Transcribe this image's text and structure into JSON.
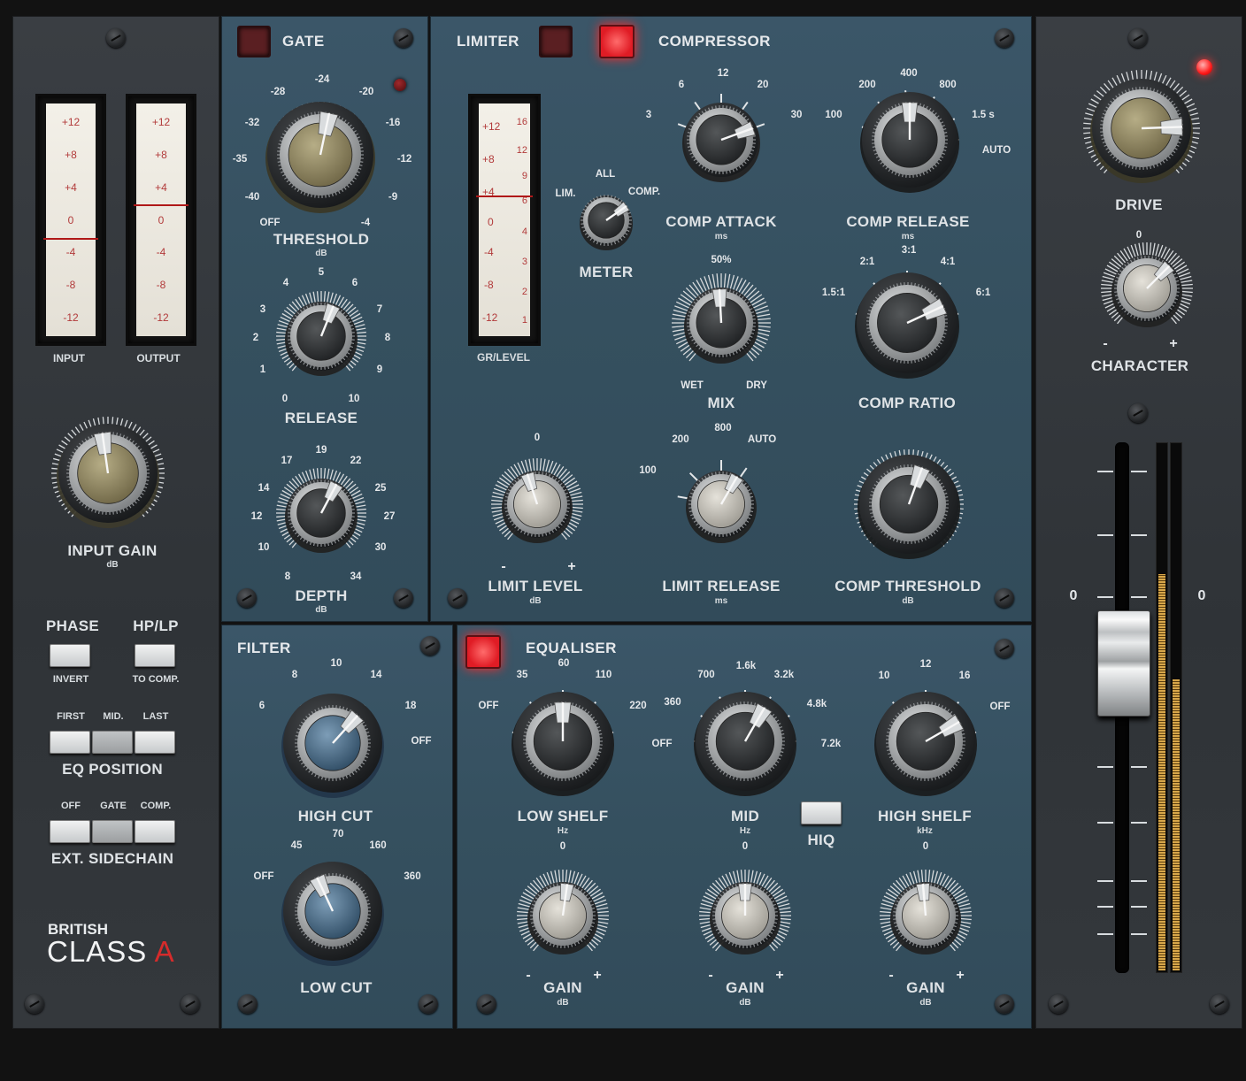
{
  "input_section": {
    "input_meter_label": "INPUT",
    "output_meter_label": "OUTPUT",
    "meter_scale": [
      "+12",
      "+8",
      "+4",
      "0",
      "-4",
      "-8",
      "-12"
    ],
    "input_gain": {
      "label": "INPUT GAIN",
      "unit": "dB"
    },
    "phase": {
      "label": "PHASE",
      "sub": "INVERT"
    },
    "hplp": {
      "label": "HP/LP",
      "sub": "TO COMP."
    },
    "eq_position": {
      "label": "EQ POSITION",
      "options": [
        "FIRST",
        "MID.",
        "LAST"
      ]
    },
    "ext_sidechain": {
      "label": "EXT. SIDECHAIN",
      "options": [
        "OFF",
        "GATE",
        "COMP."
      ]
    },
    "brand": {
      "line1": "BRITISH",
      "line2a": "CLASS ",
      "line2b": "A"
    }
  },
  "gate": {
    "title": "GATE",
    "threshold": {
      "label": "THRESHOLD",
      "unit": "dB",
      "scale": [
        "OFF",
        "-40",
        "-35",
        "-32",
        "-28",
        "-24",
        "-20",
        "-16",
        "-12",
        "-9",
        "-4"
      ]
    },
    "release": {
      "label": "RELEASE",
      "scale": [
        "0",
        "1",
        "2",
        "3",
        "4",
        "5",
        "6",
        "7",
        "8",
        "9",
        "10"
      ]
    },
    "depth": {
      "label": "DEPTH",
      "unit": "dB",
      "scale": [
        "8",
        "10",
        "12",
        "14",
        "17",
        "19",
        "22",
        "25",
        "27",
        "30",
        "34"
      ]
    }
  },
  "compressor": {
    "limiter_title": "LIMITER",
    "compressor_title": "COMPRESSOR",
    "gr_meter_label": "GR/LEVEL",
    "gr_scale_left": [
      "+12",
      "+8",
      "+4",
      "0",
      "-4",
      "-8",
      "-12"
    ],
    "gr_scale_right": [
      "16",
      "12",
      "9",
      "6",
      "4",
      "3",
      "2",
      "1"
    ],
    "meter": {
      "label": "METER",
      "options": [
        "LIM.",
        "ALL",
        "COMP."
      ]
    },
    "comp_attack": {
      "label": "COMP ATTACK",
      "unit": "ms",
      "scale": [
        "3",
        "6",
        "12",
        "20",
        "30"
      ]
    },
    "comp_release": {
      "label": "COMP RELEASE",
      "unit": "ms",
      "scale": [
        "100",
        "200",
        "400",
        "800",
        "1.5 s",
        "AUTO"
      ]
    },
    "mix": {
      "label": "MIX",
      "top": "50%",
      "left": "WET",
      "right": "DRY"
    },
    "comp_ratio": {
      "label": "COMP RATIO",
      "scale": [
        "1.5:1",
        "2:1",
        "3:1",
        "4:1",
        "6:1"
      ]
    },
    "limit_level": {
      "label": "LIMIT LEVEL",
      "unit": "dB",
      "top": "0",
      "minus": "-",
      "plus": "+"
    },
    "limit_release": {
      "label": "LIMIT RELEASE",
      "unit": "ms",
      "scale": [
        "100",
        "200",
        "800",
        "AUTO"
      ]
    },
    "comp_threshold": {
      "label": "COMP THRESHOLD",
      "unit": "dB"
    }
  },
  "filter": {
    "title": "FILTER",
    "high_cut": {
      "label": "HIGH CUT",
      "scale": [
        "6",
        "8",
        "10",
        "14",
        "18",
        "OFF"
      ]
    },
    "low_cut": {
      "label": "LOW CUT",
      "scale": [
        "OFF",
        "45",
        "70",
        "160",
        "360"
      ]
    }
  },
  "equaliser": {
    "title": "EQUALISER",
    "low_shelf": {
      "label": "LOW SHELF",
      "unit": "Hz",
      "scale": [
        "OFF",
        "35",
        "60",
        "110",
        "220"
      ]
    },
    "mid": {
      "label": "MID",
      "unit": "Hz",
      "scale": [
        "OFF",
        "360",
        "700",
        "1.6k",
        "3.2k",
        "4.8k",
        "7.2k"
      ]
    },
    "hiq": {
      "label": "HIQ"
    },
    "high_shelf": {
      "label": "HIGH SHELF",
      "unit": "kHz",
      "scale": [
        "10",
        "12",
        "16",
        "OFF"
      ]
    },
    "gain": {
      "label": "GAIN",
      "unit": "dB",
      "top": "0",
      "minus": "-",
      "plus": "+"
    }
  },
  "output_section": {
    "drive": {
      "label": "DRIVE"
    },
    "character": {
      "label": "CHARACTER",
      "top": "0",
      "minus": "-",
      "plus": "+"
    },
    "fader_left_label": "0",
    "fader_right_label": "0",
    "output_meter_levels": [
      0.75,
      0.55
    ]
  },
  "colors": {
    "panel_blue": "#35505f",
    "panel_dark": "#33373b",
    "led_red": "#ff1a1a",
    "meter_amber": "#d8a74a"
  }
}
